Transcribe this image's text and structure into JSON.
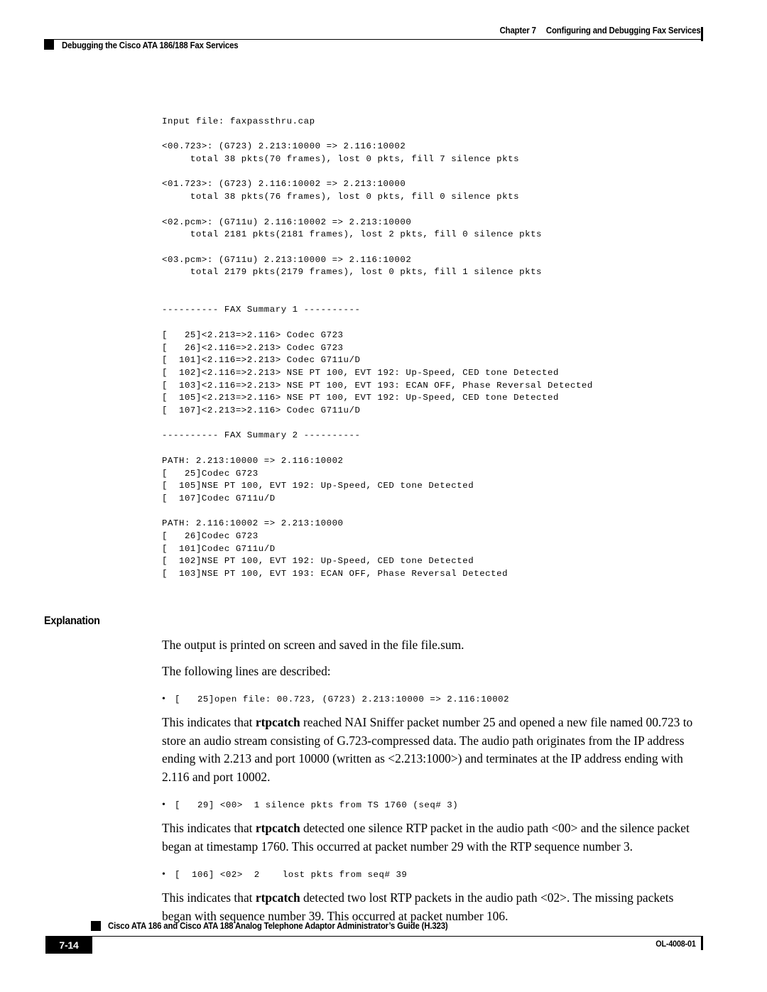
{
  "header": {
    "chapter_number": "Chapter 7",
    "chapter_title": "Configuring and Debugging Fax Services",
    "running_title": "Debugging the Cisco ATA 186/188 Fax Services"
  },
  "code_output": {
    "lines": [
      "Input file: faxpassthru.cap",
      "",
      "<00.723>: (G723) 2.213:10000 => 2.116:10002",
      "     total 38 pkts(70 frames), lost 0 pkts, fill 7 silence pkts",
      "",
      "<01.723>: (G723) 2.116:10002 => 2.213:10000",
      "     total 38 pkts(76 frames), lost 0 pkts, fill 0 silence pkts",
      "",
      "<02.pcm>: (G711u) 2.116:10002 => 2.213:10000",
      "     total 2181 pkts(2181 frames), lost 2 pkts, fill 0 silence pkts",
      "",
      "<03.pcm>: (G711u) 2.213:10000 => 2.116:10002",
      "     total 2179 pkts(2179 frames), lost 0 pkts, fill 1 silence pkts",
      "",
      "",
      "---------- FAX Summary 1 ----------",
      "",
      "[   25]<2.213=>2.116> Codec G723",
      "[   26]<2.116=>2.213> Codec G723",
      "[  101]<2.116=>2.213> Codec G711u/D",
      "[  102]<2.116=>2.213> NSE PT 100, EVT 192: Up-Speed, CED tone Detected",
      "[  103]<2.116=>2.213> NSE PT 100, EVT 193: ECAN OFF, Phase Reversal Detected",
      "[  105]<2.213=>2.116> NSE PT 100, EVT 192: Up-Speed, CED tone Detected",
      "[  107]<2.213=>2.116> Codec G711u/D",
      "",
      "---------- FAX Summary 2 ----------",
      "",
      "PATH: 2.213:10000 => 2.116:10002",
      "[   25]Codec G723",
      "[  105]NSE PT 100, EVT 192: Up-Speed, CED tone Detected",
      "[  107]Codec G711u/D",
      "",
      "PATH: 2.116:10002 => 2.213:10000",
      "[   26]Codec G723",
      "[  101]Codec G711u/D",
      "[  102]NSE PT 100, EVT 192: Up-Speed, CED tone Detected",
      "[  103]NSE PT 100, EVT 193: ECAN OFF, Phase Reversal Detected"
    ]
  },
  "explanation": {
    "heading": "Explanation",
    "intro_1": "The output is printed on screen and saved in the file file.sum.",
    "intro_2": "The following lines are described:",
    "items": [
      {
        "bullet": "•",
        "code": "[   25]open file: 00.723, (G723) 2.213:10000 => 2.116:10002",
        "para_pre": "This indicates that ",
        "para_bold": "rtpcatch",
        "para_post": " reached NAI Sniffer packet number 25 and opened a new file named 00.723 to store an audio stream consisting of G.723-compressed data. The audio path originates from the IP address ending with 2.213 and port 10000 (written as <2.213:1000>) and terminates at the IP address ending with 2.116 and port 10002."
      },
      {
        "bullet": "•",
        "code": "[   29] <00>  1 silence pkts from TS 1760 (seq# 3)",
        "para_pre": "This indicates that ",
        "para_bold": "rtpcatch",
        "para_post": " detected one silence RTP packet in the audio path <00> and the silence packet began at timestamp 1760. This occurred at packet number 29 with the RTP sequence number 3."
      },
      {
        "bullet": "•",
        "code": "[  106] <02>  2    lost pkts from seq# 39",
        "para_pre": "This indicates that  ",
        "para_bold": "rtpcatch",
        "para_post": " detected two lost RTP packets in the audio path <02>.  The missing packets began with sequence number 39. This occurred at packet number 106."
      }
    ]
  },
  "footer": {
    "doc_title": "Cisco ATA 186 and Cisco ATA 188 Analog Telephone Adaptor Administrator’s Guide (H.323)",
    "page_number": "7-14",
    "doc_number": "OL-4008-01"
  }
}
